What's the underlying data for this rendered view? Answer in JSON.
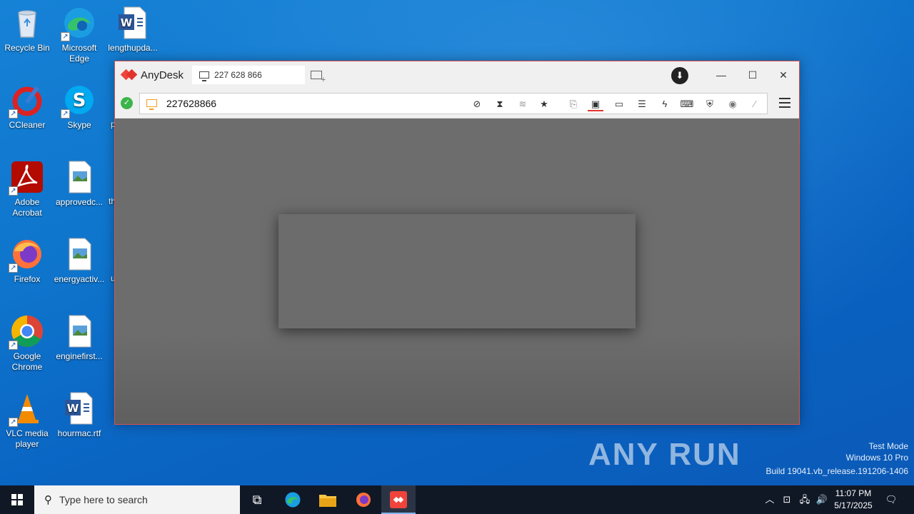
{
  "desktop": {
    "icons": [
      {
        "label": "Recycle Bin"
      },
      {
        "label": "Microsoft Edge"
      },
      {
        "label": "lengthupda..."
      },
      {
        "label": "CCleaner"
      },
      {
        "label": "Skype"
      },
      {
        "label": "Adobe Acrobat"
      },
      {
        "label": "approvedc..."
      },
      {
        "label": "Firefox"
      },
      {
        "label": "energyactiv..."
      },
      {
        "label": "Google Chrome"
      },
      {
        "label": "enginefirst..."
      },
      {
        "label": "VLC media player"
      },
      {
        "label": "hourmac.rtf"
      }
    ],
    "clipped_labels": [
      "p",
      "th",
      "u"
    ]
  },
  "anydesk": {
    "app_name": "AnyDesk",
    "tab_label": "227 628 866",
    "address_value": "227628866",
    "status_color": "#3bb54a",
    "accent_color": "#ef443b"
  },
  "watermark": {
    "logo": "ANY RUN",
    "line1": "Test Mode",
    "line2": "Windows 10 Pro",
    "line3": "Build 19041.vb_release.191206-1406"
  },
  "taskbar": {
    "search_placeholder": "Type here to search",
    "time": "11:07 PM",
    "date": "5/17/2025"
  }
}
